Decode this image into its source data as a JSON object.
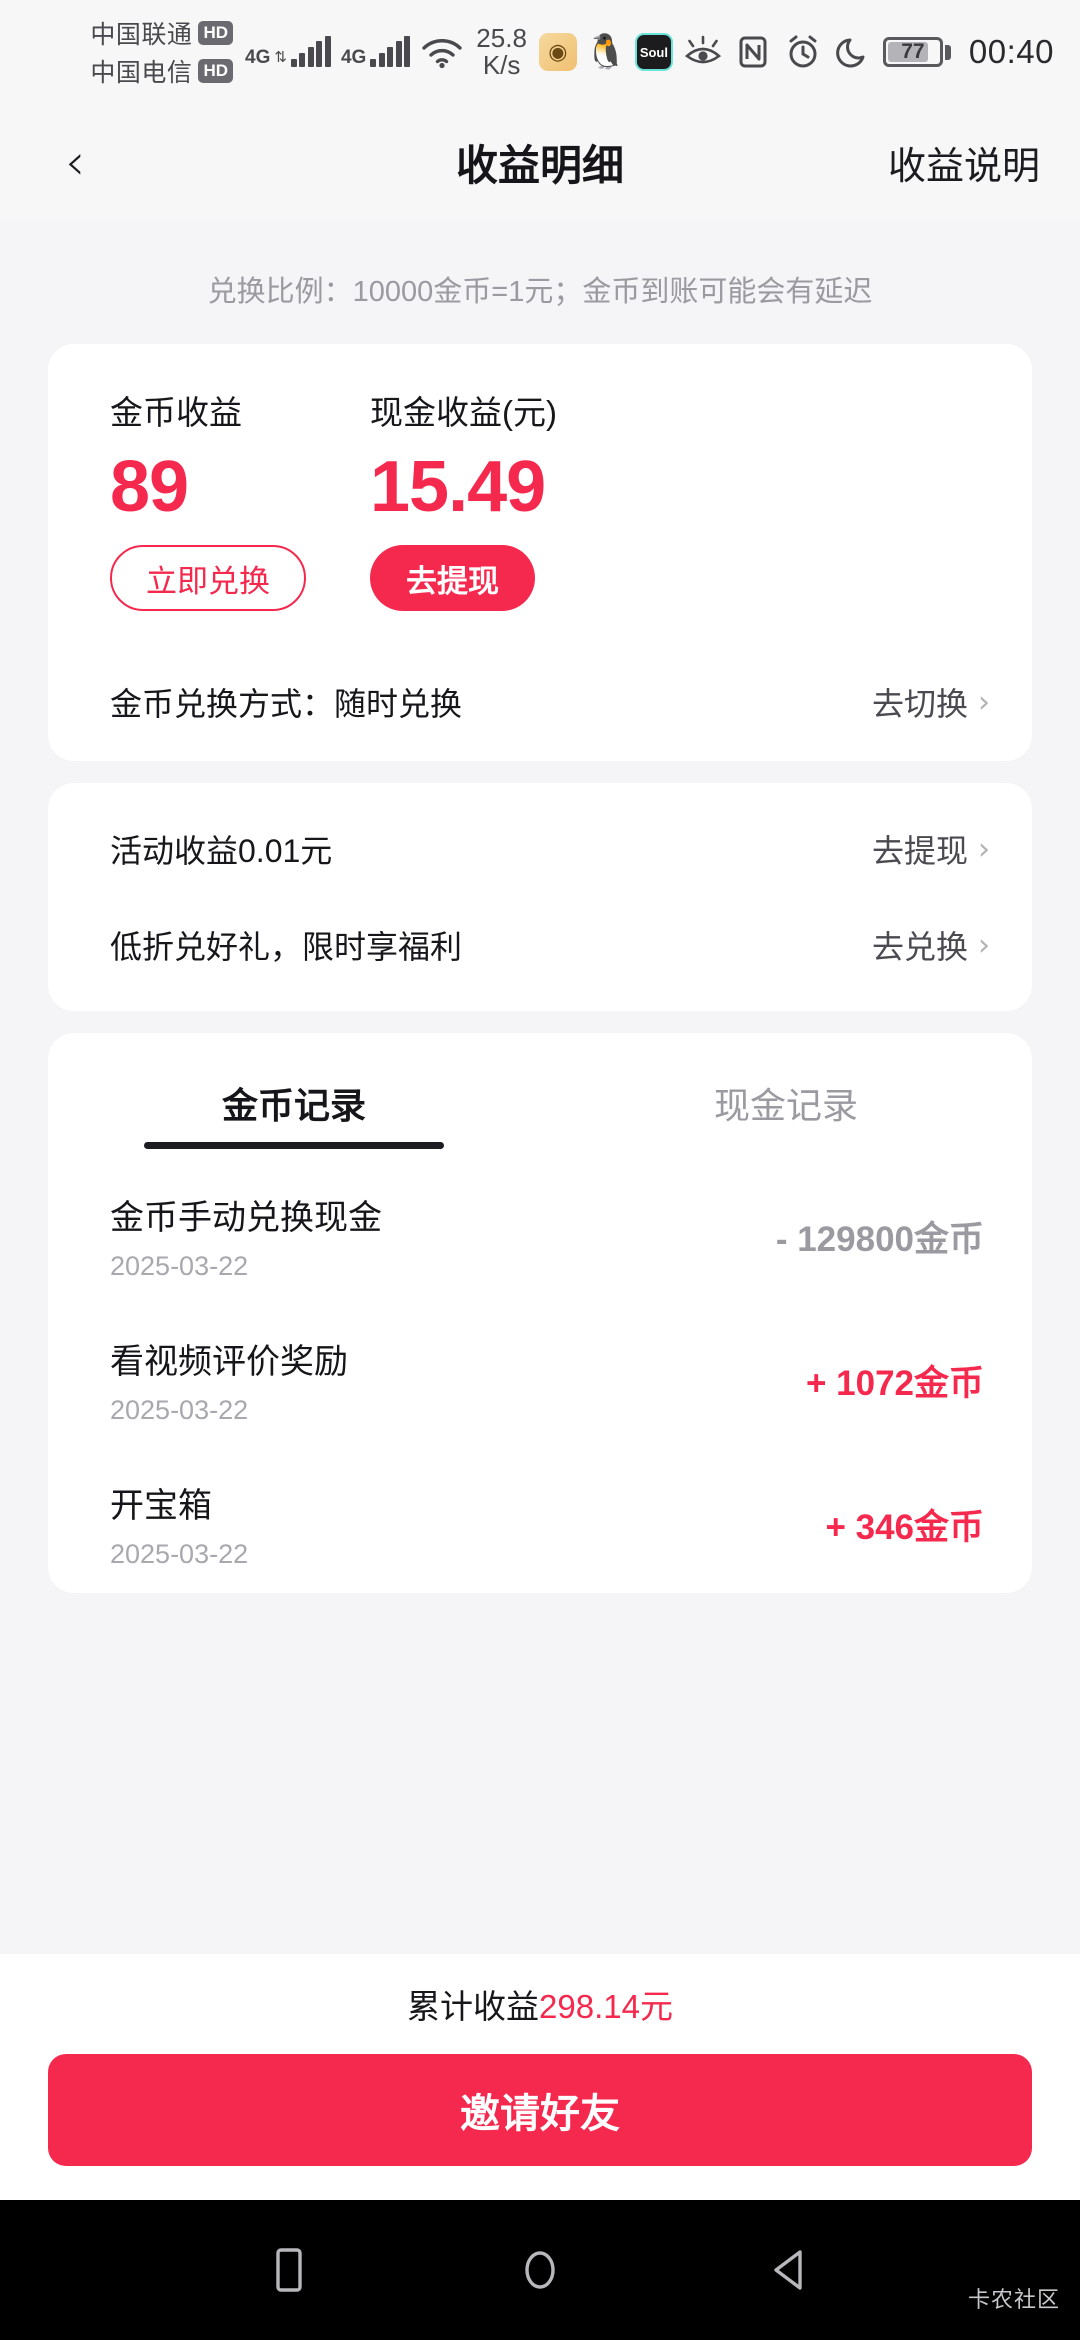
{
  "status_bar": {
    "carrier_primary": "中国联通",
    "carrier_secondary": "中国电信",
    "hd_badge": "HD",
    "network_primary": "4G",
    "network_secondary": "4G",
    "net_speed_value": "25.8",
    "net_speed_unit": "K/s",
    "app_icon_soul_label": "Soul",
    "battery_percent": "77",
    "time": "00:40"
  },
  "header": {
    "title": "收益明细",
    "action_label": "收益说明"
  },
  "ratio_note": "兑换比例：10000金币=1元；金币到账可能会有延迟",
  "earnings": {
    "coins": {
      "label": "金币收益",
      "value": "89",
      "button": "立即兑换"
    },
    "cash": {
      "label": "现金收益(元)",
      "value": "15.49",
      "button": "去提现"
    },
    "exchange_mode_row": {
      "label": "金币兑换方式：随时兑换",
      "action": "去切换"
    }
  },
  "quick_rows": [
    {
      "label": "活动收益0.01元",
      "action": "去提现"
    },
    {
      "label": "低折兑好礼，限时享福利",
      "action": "去兑换"
    }
  ],
  "records": {
    "tabs": [
      {
        "label": "金币记录",
        "active": true
      },
      {
        "label": "现金记录",
        "active": false
      }
    ],
    "items": [
      {
        "title": "金币手动兑换现金",
        "date": "2025-03-22",
        "amount": "- 129800金币",
        "sign": "neg"
      },
      {
        "title": "看视频评价奖励",
        "date": "2025-03-22",
        "amount": "+ 1072金币",
        "sign": "pos"
      },
      {
        "title": "开宝箱",
        "date": "2025-03-22",
        "amount": "+ 346金币",
        "sign": "pos"
      }
    ]
  },
  "footer": {
    "total_label": "累计收益",
    "total_amount": "298.14元",
    "invite_button": "邀请好友"
  },
  "watermark": "卡农社区",
  "colors": {
    "accent_red": "#f5294e",
    "page_bg": "#f5f5f7",
    "card_bg": "#ffffff",
    "text_primary": "#16161a",
    "text_muted": "#9a9aa0"
  }
}
